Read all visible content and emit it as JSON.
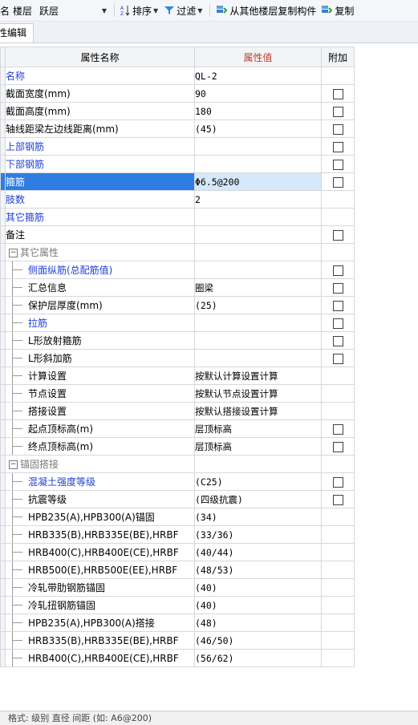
{
  "toolbar": {
    "name_label": "名",
    "floor_label": "楼层",
    "floor_value": "跃层",
    "sort_label": "排序",
    "filter_label": "过滤",
    "copy_label": "从其他楼层复制构件",
    "copy2_label": "复制"
  },
  "tab": {
    "label": "性编辑"
  },
  "grid": {
    "columns": {
      "name": "属性名称",
      "value": "属性值",
      "extra": "附加"
    },
    "rows": [
      {
        "name": "名称",
        "value": "QL-2",
        "style": "blue",
        "check": false,
        "indent": false
      },
      {
        "name": "截面宽度(mm)",
        "value": "90",
        "style": "",
        "check": true,
        "indent": false
      },
      {
        "name": "截面高度(mm)",
        "value": "180",
        "style": "",
        "check": true,
        "indent": false
      },
      {
        "name": "轴线距梁左边线距离(mm)",
        "value": "(45)",
        "style": "",
        "check": true,
        "indent": false
      },
      {
        "name": "上部钢筋",
        "value": "",
        "style": "blue",
        "check": true,
        "indent": false
      },
      {
        "name": "下部钢筋",
        "value": "",
        "style": "blue",
        "check": true,
        "indent": false
      },
      {
        "name": "箍筋",
        "value": "Φ6.5@200",
        "style": "sel",
        "check": true,
        "indent": false
      },
      {
        "name": "肢数",
        "value": "2",
        "style": "blue",
        "check": false,
        "indent": false
      },
      {
        "name": "其它箍筋",
        "value": "",
        "style": "blue",
        "check": false,
        "indent": false
      },
      {
        "name": "备注",
        "value": "",
        "style": "",
        "check": true,
        "indent": false
      },
      {
        "name": "其它属性",
        "value": "",
        "style": "group",
        "check": false,
        "indent": false
      },
      {
        "name": "侧面纵筋(总配筋值)",
        "value": "",
        "style": "blue",
        "check": true,
        "indent": true
      },
      {
        "name": "汇总信息",
        "value": "圈梁",
        "style": "",
        "check": true,
        "indent": true
      },
      {
        "name": "保护层厚度(mm)",
        "value": "(25)",
        "style": "",
        "check": true,
        "indent": true
      },
      {
        "name": "拉筋",
        "value": "",
        "style": "blue",
        "check": true,
        "indent": true
      },
      {
        "name": "L形放射箍筋",
        "value": "",
        "style": "",
        "check": true,
        "indent": true
      },
      {
        "name": "L形斜加筋",
        "value": "",
        "style": "",
        "check": true,
        "indent": true
      },
      {
        "name": "计算设置",
        "value": "按默认计算设置计算",
        "style": "",
        "check": false,
        "indent": true
      },
      {
        "name": "节点设置",
        "value": "按默认节点设置计算",
        "style": "",
        "check": false,
        "indent": true
      },
      {
        "name": "搭接设置",
        "value": "按默认搭接设置计算",
        "style": "",
        "check": false,
        "indent": true
      },
      {
        "name": "起点顶标高(m)",
        "value": "层顶标高",
        "style": "",
        "check": true,
        "indent": true
      },
      {
        "name": "终点顶标高(m)",
        "value": "层顶标高",
        "style": "",
        "check": true,
        "indent": true
      },
      {
        "name": "锚固搭接",
        "value": "",
        "style": "group",
        "check": false,
        "indent": false
      },
      {
        "name": "混凝土强度等级",
        "value": "(C25)",
        "style": "blue",
        "check": true,
        "indent": true
      },
      {
        "name": "抗震等级",
        "value": "(四级抗震)",
        "style": "",
        "check": true,
        "indent": true
      },
      {
        "name": "HPB235(A),HPB300(A)锚固",
        "value": "(34)",
        "style": "",
        "check": false,
        "indent": true
      },
      {
        "name": "HRB335(B),HRB335E(BE),HRBF",
        "value": "(33/36)",
        "style": "",
        "check": false,
        "indent": true
      },
      {
        "name": "HRB400(C),HRB400E(CE),HRBF",
        "value": "(40/44)",
        "style": "",
        "check": false,
        "indent": true
      },
      {
        "name": "HRB500(E),HRB500E(EE),HRBF",
        "value": "(48/53)",
        "style": "",
        "check": false,
        "indent": true
      },
      {
        "name": "冷轧带肋钢筋锚固",
        "value": "(40)",
        "style": "",
        "check": false,
        "indent": true
      },
      {
        "name": "冷轧扭钢筋锚固",
        "value": "(40)",
        "style": "",
        "check": false,
        "indent": true
      },
      {
        "name": "HPB235(A),HPB300(A)搭接",
        "value": "(48)",
        "style": "",
        "check": false,
        "indent": true
      },
      {
        "name": "HRB335(B),HRB335E(BE),HRBF",
        "value": "(46/50)",
        "style": "",
        "check": false,
        "indent": true
      },
      {
        "name": "HRB400(C),HRB400E(CE),HRBF",
        "value": "(56/62)",
        "style": "",
        "check": false,
        "indent": true
      }
    ]
  },
  "statusbar": {
    "text": "格式: 级别 直径 间距 (如: A6@200)"
  },
  "colors": {
    "selected": "#2f7de1",
    "blue_text": "#1f3fd6",
    "header_value": "#f6c978"
  }
}
